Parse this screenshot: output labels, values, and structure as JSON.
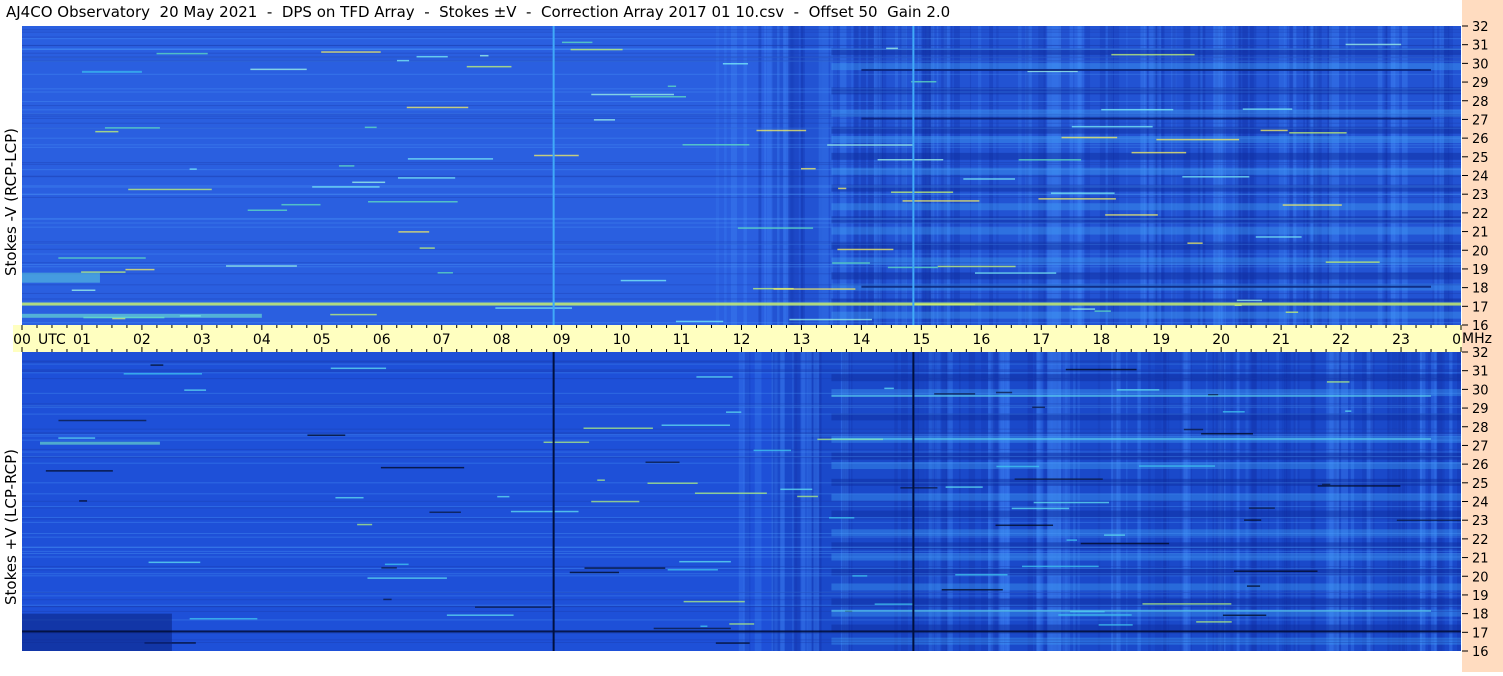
{
  "title": "AJ4CO Observatory  20 May 2021  -  DPS on TFD Array  -  Stokes ±V  -  Correction Array 2017 01 10.csv  -  Offset 50  Gain 2.0",
  "chart_data": [
    {
      "type": "heatmap",
      "name": "stokes-minus-v",
      "ylabel": "Stokes -V (RCP-LCP)",
      "x_ticks": [
        "00",
        "01",
        "02",
        "03",
        "04",
        "05",
        "06",
        "07",
        "08",
        "09",
        "10",
        "11",
        "12",
        "13",
        "14",
        "15",
        "16",
        "17",
        "18",
        "19",
        "20",
        "21",
        "22",
        "23",
        "00"
      ],
      "x_unit": "UTC",
      "y_ticks": [
        32,
        31,
        30,
        29,
        28,
        27,
        26,
        25,
        24,
        23,
        22,
        21,
        20,
        19,
        18,
        17,
        16
      ],
      "y_unit": "MHz",
      "ylim": [
        16,
        32
      ],
      "xlim_hours": [
        0,
        24
      ],
      "background_color": "#2a5fe0",
      "vertical_lines": [
        {
          "hour": 8.85,
          "color": "#40aaf8"
        },
        {
          "hour": 14.85,
          "color": "#40aaf8"
        }
      ]
    },
    {
      "type": "heatmap",
      "name": "stokes-plus-v",
      "ylabel": "Stokes +V (LCP-RCP)",
      "x_ticks": [
        "00",
        "01",
        "02",
        "03",
        "04",
        "05",
        "06",
        "07",
        "08",
        "09",
        "10",
        "11",
        "12",
        "13",
        "14",
        "15",
        "16",
        "17",
        "18",
        "19",
        "20",
        "21",
        "22",
        "23",
        "00"
      ],
      "x_unit": "UTC",
      "y_ticks": [
        32,
        31,
        30,
        29,
        28,
        27,
        26,
        25,
        24,
        23,
        22,
        21,
        20,
        19,
        18,
        17,
        16
      ],
      "y_unit": "MHz",
      "ylim": [
        16,
        32
      ],
      "xlim_hours": [
        0,
        24
      ],
      "background_color": "#1e50d8",
      "vertical_lines": [
        {
          "hour": 8.85,
          "color": "#001040"
        },
        {
          "hour": 14.85,
          "color": "#001040"
        }
      ]
    }
  ]
}
